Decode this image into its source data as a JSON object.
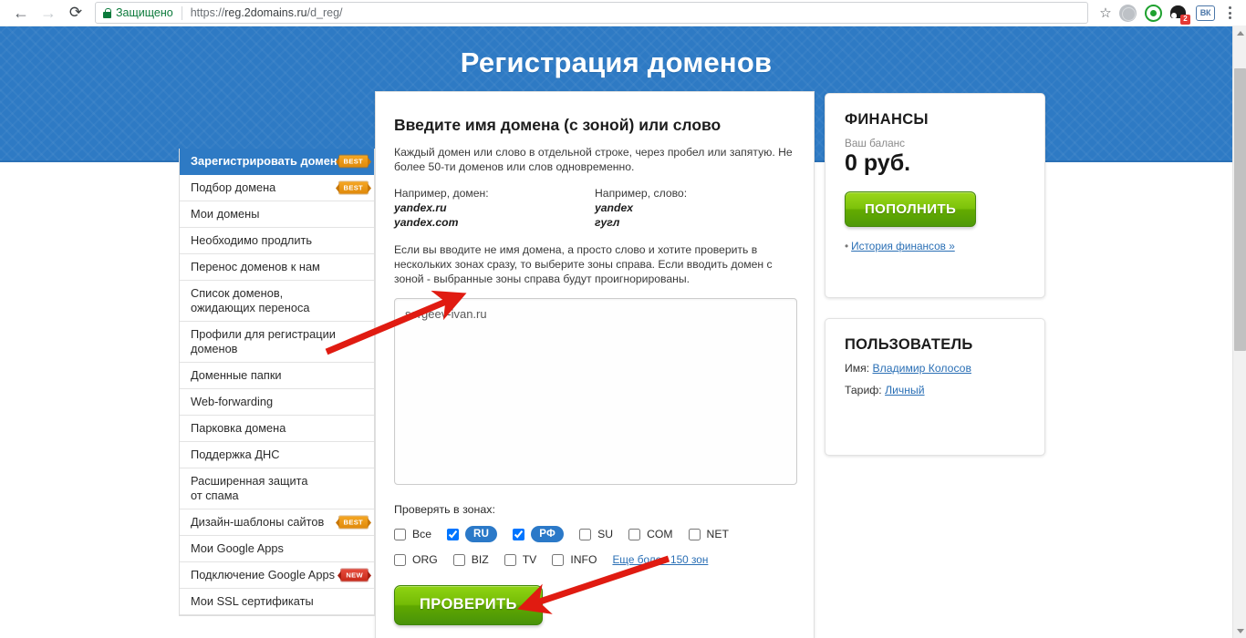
{
  "browser": {
    "back_icon": "back-arrow-icon",
    "forward_icon": "forward-arrow-icon",
    "reload_icon": "reload-icon",
    "security_label": "Защищено",
    "url": "https://reg.2domains.ru/d_reg/",
    "url_scheme": "https://",
    "url_host": "reg.2domains.ru",
    "url_path": "/d_reg/",
    "star_glyph": "☆",
    "extensions": [
      {
        "name": "globe-extension-icon",
        "badge": ""
      },
      {
        "name": "green-record-extension-icon",
        "badge": ""
      },
      {
        "name": "dark-mask-extension-icon",
        "badge": "2"
      },
      {
        "name": "vk-extension-icon",
        "label": "ВК",
        "badge": ""
      }
    ],
    "menu_icon": "three-dot-menu-icon"
  },
  "hero": {
    "title": "Регистрация доменов"
  },
  "sidebar": {
    "items": [
      {
        "label": "Зарегистрировать домен",
        "badge": "BEST",
        "badge_type": "best",
        "active": true
      },
      {
        "label": "Подбор домена",
        "badge": "BEST",
        "badge_type": "best",
        "active": false
      },
      {
        "label": "Мои домены",
        "badge": "",
        "badge_type": "",
        "active": false
      },
      {
        "label": "Необходимо продлить",
        "badge": "",
        "badge_type": "",
        "active": false
      },
      {
        "label": "Перенос доменов к нам",
        "badge": "",
        "badge_type": "",
        "active": false
      },
      {
        "label": "Список доменов,\nожидающих переноса",
        "badge": "",
        "badge_type": "",
        "active": false
      },
      {
        "label": "Профили для регистрации\nдоменов",
        "badge": "",
        "badge_type": "",
        "active": false
      },
      {
        "label": "Доменные папки",
        "badge": "",
        "badge_type": "",
        "active": false
      },
      {
        "label": "Web-forwarding",
        "badge": "",
        "badge_type": "",
        "active": false
      },
      {
        "label": "Парковка домена",
        "badge": "",
        "badge_type": "",
        "active": false
      },
      {
        "label": "Поддержка ДНС",
        "badge": "",
        "badge_type": "",
        "active": false
      },
      {
        "label": "Расширенная защита\nот спама",
        "badge": "",
        "badge_type": "",
        "active": false
      },
      {
        "label": "Дизайн-шаблоны сайтов",
        "badge": "BEST",
        "badge_type": "best",
        "active": false
      },
      {
        "label": "Мои Google Apps",
        "badge": "",
        "badge_type": "",
        "active": false
      },
      {
        "label": "Подключение Google Apps",
        "badge": "NEW",
        "badge_type": "new",
        "active": false
      },
      {
        "label": "Мои SSL сертификаты",
        "badge": "",
        "badge_type": "",
        "active": false
      }
    ]
  },
  "main": {
    "heading": "Введите имя домена (с зоной) или слово",
    "intro": "Каждый домен или слово в отдельной строке, через пробел или запятую. Не более 50-ти доменов или слов одновременно.",
    "example_domain_label": "Например, домен:",
    "example_domain_1": "yandex.ru",
    "example_domain_2": "yandex.com",
    "example_word_label": "Например, слово:",
    "example_word_1": "yandex",
    "example_word_2": "гугл",
    "note": "Если вы вводите не имя домена, а просто слово и хотите проверить в нескольких зонах сразу, то выберите зоны справа. Если вводить домен с зоной - выбранные зоны справа будут проигнорированы.",
    "textarea_value": "sergeev-ivan.ru",
    "textarea_placeholder": "",
    "zones_label": "Проверять в зонах:",
    "zones_row1": [
      {
        "label": "Все",
        "checked": false,
        "pill": false
      },
      {
        "label": "RU",
        "checked": true,
        "pill": true
      },
      {
        "label": "РФ",
        "checked": true,
        "pill": true
      },
      {
        "label": "SU",
        "checked": false,
        "pill": false
      },
      {
        "label": "COM",
        "checked": false,
        "pill": false
      },
      {
        "label": "NET",
        "checked": false,
        "pill": false
      }
    ],
    "zones_row2": [
      {
        "label": "ORG",
        "checked": false,
        "pill": false
      },
      {
        "label": "BIZ",
        "checked": false,
        "pill": false
      },
      {
        "label": "TV",
        "checked": false,
        "pill": false
      },
      {
        "label": "INFO",
        "checked": false,
        "pill": false
      }
    ],
    "zones_more_link": "Еще более 150 зон",
    "submit_label": "ПРОВЕРИТЬ"
  },
  "finance_card": {
    "title": "ФИНАНСЫ",
    "balance_label": "Ваш баланс",
    "balance_value": "0 руб.",
    "topup_label": "ПОПОЛНИТЬ",
    "history_bullet": "•",
    "history_link": "История финансов »"
  },
  "user_card": {
    "title": "ПОЛЬЗОВАТЕЛЬ",
    "name_label": "Имя:",
    "name_value": "Владимир Колосов",
    "tariff_label": "Тариф:",
    "tariff_value": "Личный"
  },
  "annotations": {
    "arrow_color": "#e01b11",
    "arrow_1_target": "domain-textarea",
    "arrow_2_target": "check-button"
  },
  "colors": {
    "hero_blue": "#2e7ac4",
    "green_button": "#6ab80a",
    "link_blue": "#2a6fb5",
    "pill_blue": "#2b79c8"
  }
}
